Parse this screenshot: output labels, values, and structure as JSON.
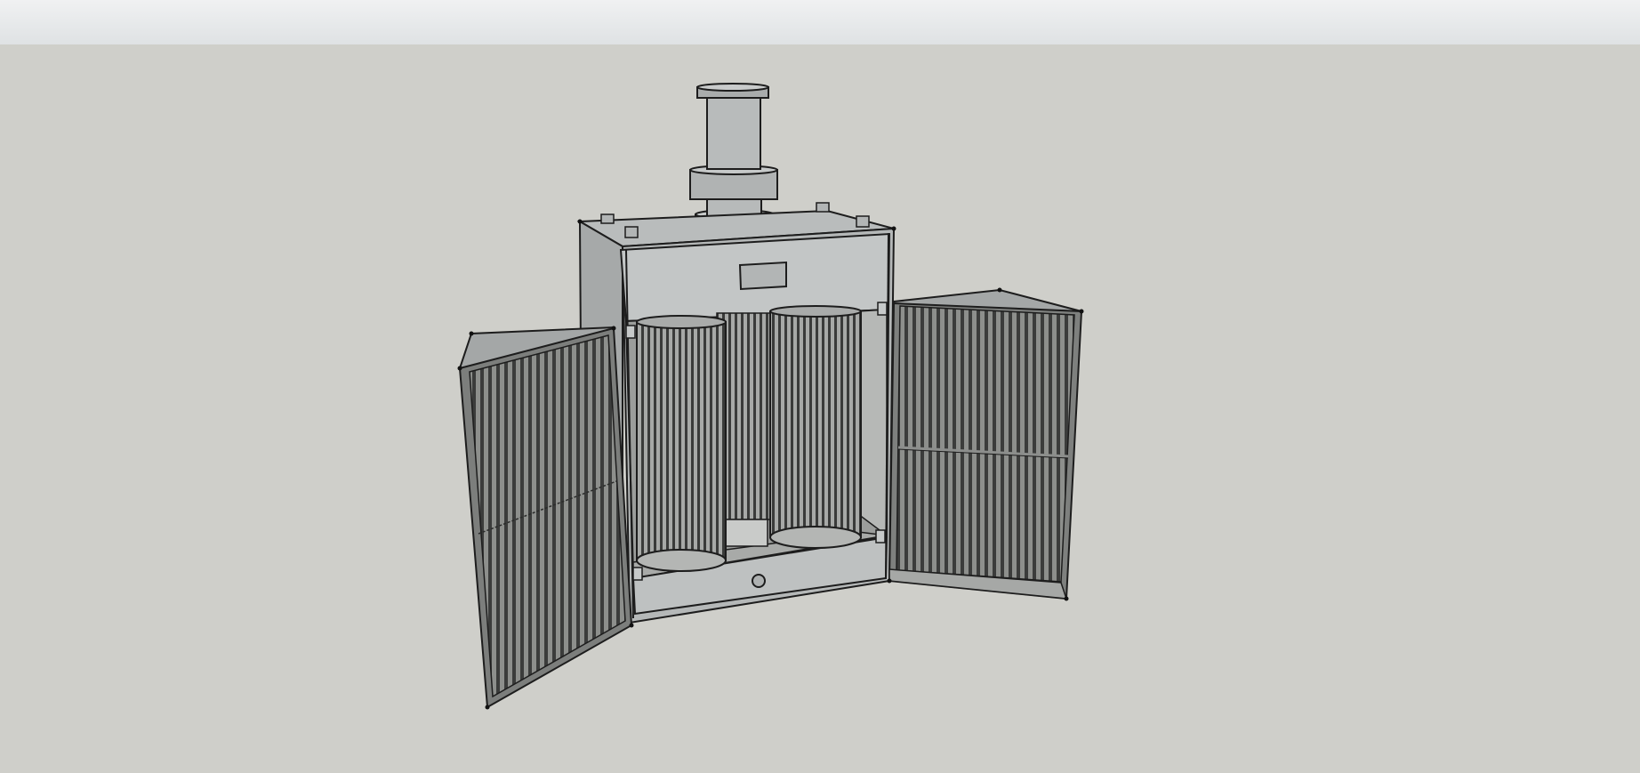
{
  "viewport": {
    "sky_color": "#e4e7e9",
    "ground_color": "#cfcfca"
  },
  "model": {
    "subject": "dust-collector-cabinet-with-open-doors",
    "colors": {
      "metal_light": "#c6c9c9",
      "metal_mid": "#a9acac",
      "metal_dark": "#8c8f8f",
      "grille": "#6f716f",
      "grille_dark": "#3a3b3a",
      "interior": "#9ea09e",
      "edge": "#1d1d1d"
    },
    "filter_cartridge_count": 2,
    "door_count": 2
  }
}
